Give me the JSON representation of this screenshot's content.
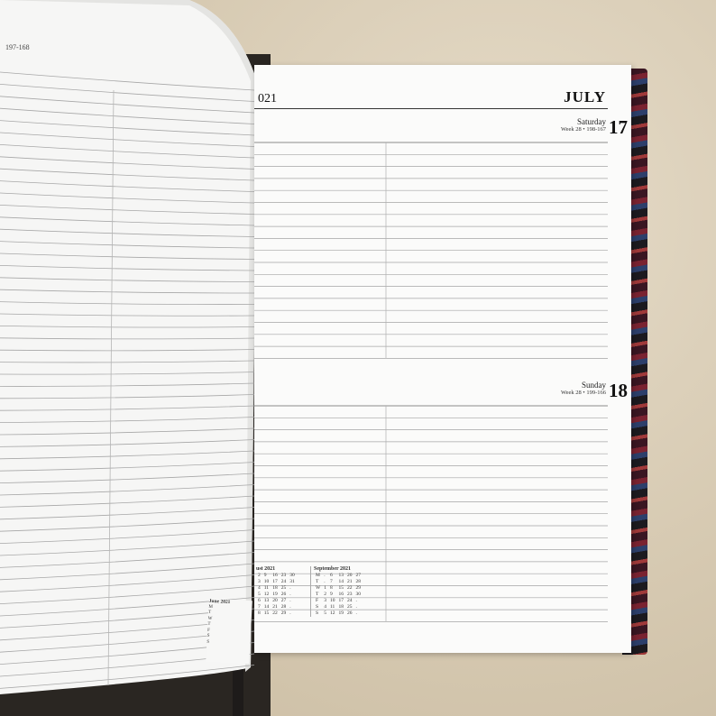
{
  "left_page": {
    "page_number": "197-168",
    "mini_calendar": {
      "title": "June 2021",
      "day_initials": [
        "M",
        "T",
        "W",
        "T",
        "F",
        "S",
        "S"
      ]
    }
  },
  "right_page": {
    "year_fragment": "021",
    "month": "JULY",
    "days": [
      {
        "name": "Saturday",
        "week": "Week 28 • 198-167",
        "number": "17"
      },
      {
        "name": "Sunday",
        "week": "Week 28 • 199-166",
        "number": "18"
      }
    ],
    "calendars": [
      {
        "title": "ust 2021",
        "rows": [
          [
            "2",
            "9",
            "16",
            "23",
            "30"
          ],
          [
            "3",
            "10",
            "17",
            "24",
            "31"
          ],
          [
            "4",
            "11",
            "18",
            "25",
            "."
          ],
          [
            "5",
            "12",
            "19",
            "26",
            "."
          ],
          [
            "6",
            "13",
            "20",
            "27",
            "."
          ],
          [
            "7",
            "14",
            "21",
            "28",
            "."
          ],
          [
            "8",
            "15",
            "22",
            "29",
            "."
          ]
        ]
      },
      {
        "title": "September 2021",
        "day_initials": [
          "M",
          "T",
          "W",
          "T",
          "F",
          "S",
          "S"
        ],
        "rows": [
          [
            ".",
            "6",
            "13",
            "20",
            "27"
          ],
          [
            ".",
            "7",
            "14",
            "21",
            "28"
          ],
          [
            "1",
            "8",
            "15",
            "22",
            "29"
          ],
          [
            "2",
            "9",
            "16",
            "23",
            "30"
          ],
          [
            "3",
            "10",
            "17",
            "24",
            "."
          ],
          [
            "4",
            "11",
            "18",
            "25",
            "."
          ],
          [
            "5",
            "12",
            "19",
            "26",
            "."
          ]
        ]
      }
    ]
  },
  "colors": {
    "paper": "#fbfbfa",
    "rule": "#9a9a9a",
    "cover_red": "#7a2331",
    "cover_blue": "#2d3f6b"
  }
}
